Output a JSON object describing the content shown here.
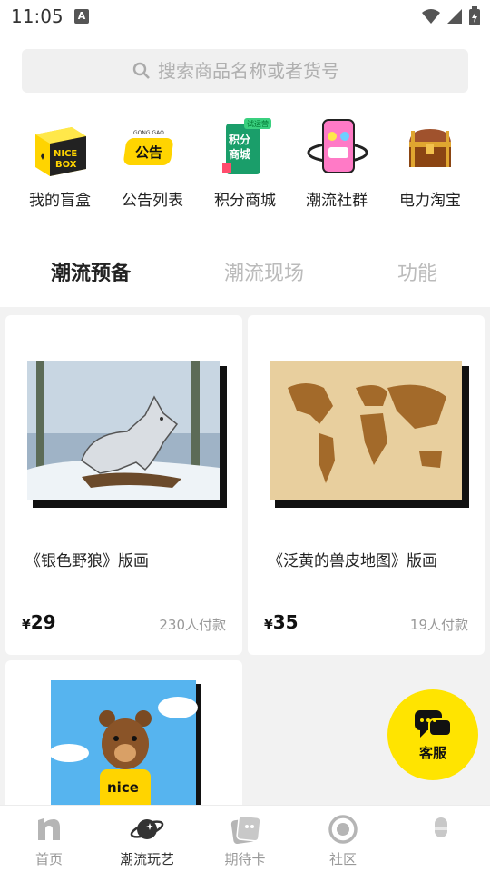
{
  "status": {
    "time": "11:05",
    "badge": "A"
  },
  "search": {
    "placeholder": "搜索商品名称或者货号"
  },
  "quick": [
    {
      "label": "我的盲盒",
      "icon": "nice-box-icon",
      "art": "NICE BOX"
    },
    {
      "label": "公告列表",
      "icon": "announcement-icon",
      "art": "公告"
    },
    {
      "label": "积分商城",
      "icon": "points-mall-icon",
      "art": "积分商城",
      "tag": "试运营"
    },
    {
      "label": "潮流社群",
      "icon": "community-phone-icon"
    },
    {
      "label": "电力淘宝",
      "icon": "treasure-chest-icon"
    }
  ],
  "tabs": [
    "潮流预备",
    "潮流现场",
    "功能"
  ],
  "products": [
    {
      "title": "《银色野狼》版画",
      "currency": "¥",
      "price": "29",
      "paid": "230人付款",
      "image": "silver-wolf-print"
    },
    {
      "title": "《泛黄的兽皮地图》版画",
      "currency": "¥",
      "price": "35",
      "paid": "19人付款",
      "image": "world-map-print"
    },
    {
      "title": "",
      "currency": "",
      "price": "",
      "paid": "",
      "image": "bear-nice-print",
      "shirt_text": "nice"
    }
  ],
  "fab": {
    "label": "客服"
  },
  "nav": [
    {
      "label": "首页",
      "icon": "home-n-icon"
    },
    {
      "label": "潮流玩艺",
      "icon": "planet-icon"
    },
    {
      "label": "期待卡",
      "icon": "card-icon"
    },
    {
      "label": "社区",
      "icon": "community-ring-icon"
    },
    {
      "label": "",
      "icon": "profile-icon"
    }
  ],
  "colors": {
    "accent": "#ffe400",
    "muted": "#b5b5b5"
  }
}
